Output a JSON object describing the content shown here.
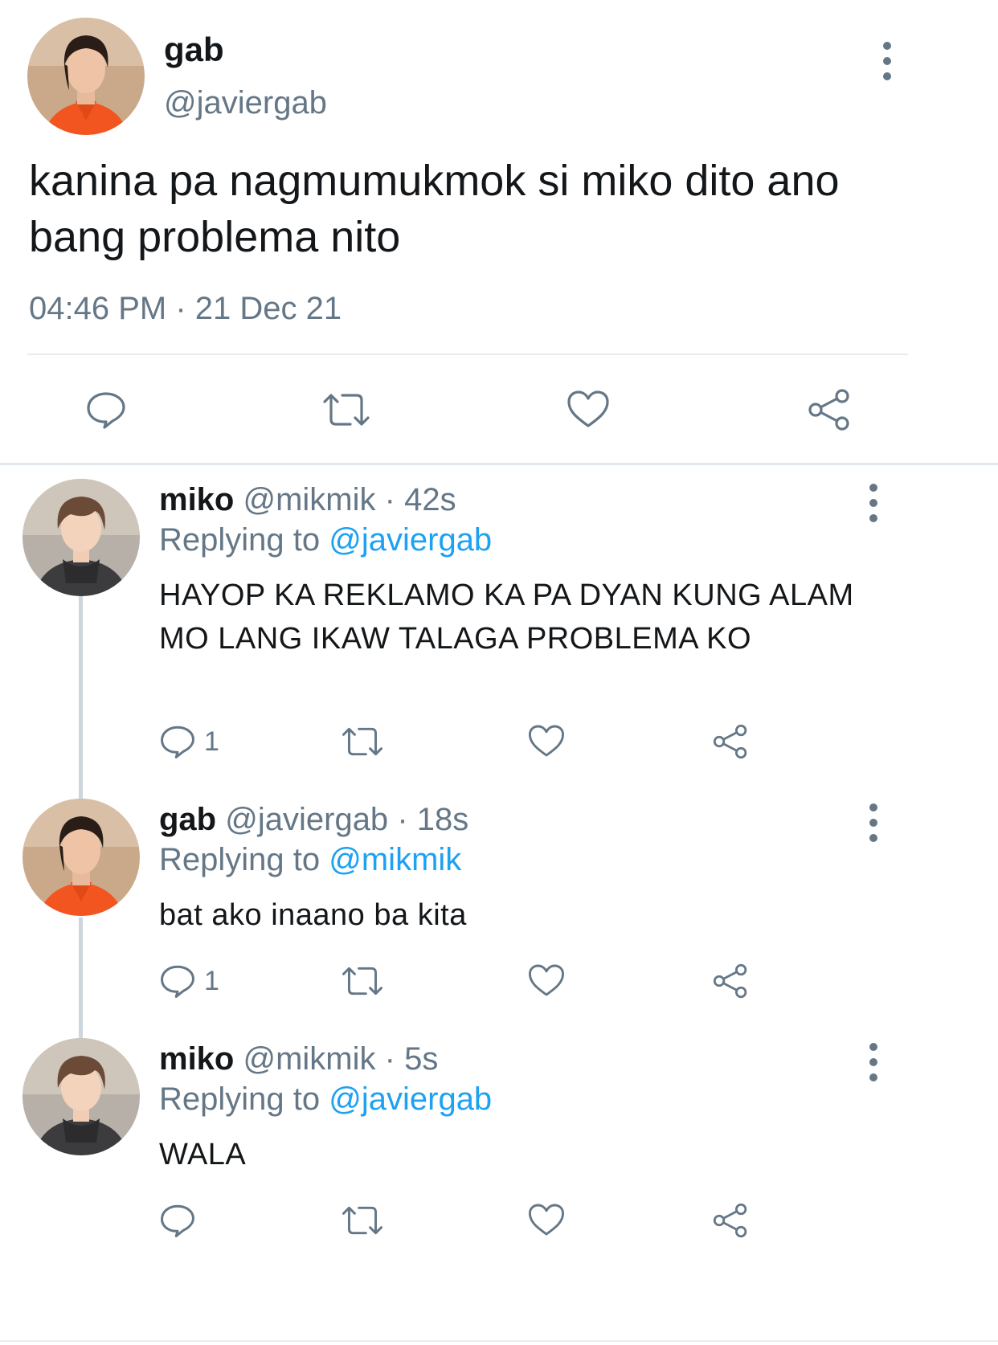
{
  "colors": {
    "text": "#14171a",
    "secondary": "#657786",
    "accent": "#1da1f2",
    "divider": "#e6ecf0"
  },
  "main_tweet": {
    "name": "gab",
    "handle": "@javiergab",
    "text": "kanina pa nagmumukmok si miko dito ano bang problema nito",
    "timestamp": "04:46 PM · 21 Dec 21",
    "avatar_icon": "avatar-gab",
    "actions": [
      "reply-icon",
      "retweet-icon",
      "like-icon",
      "share-icon"
    ]
  },
  "replies": [
    {
      "name": "miko",
      "handle": "@mikmik",
      "sep": "·",
      "time": "42s",
      "replying_label": "Replying to",
      "replying_to": "@javiergab",
      "text": "HAYOP KA REKLAMO KA PA DYAN KUNG ALAM MO LANG IKAW TALAGA PROBLEMA KO",
      "reply_count": "1"
    },
    {
      "name": "gab",
      "handle": "@javiergab",
      "sep": "·",
      "time": "18s",
      "replying_label": "Replying to",
      "replying_to": "@mikmik",
      "text": "bat ako inaano ba kita",
      "reply_count": "1"
    },
    {
      "name": "miko",
      "handle": "@mikmik",
      "sep": "·",
      "time": "5s",
      "replying_label": "Replying to",
      "replying_to": "@javiergab",
      "text": "WALA",
      "reply_count": ""
    }
  ]
}
